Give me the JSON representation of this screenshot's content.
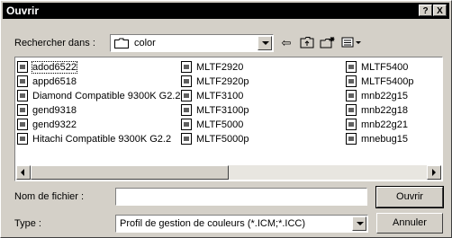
{
  "window": {
    "title": "Ouvrir",
    "help_btn": "?",
    "close_btn": "X"
  },
  "lookin": {
    "label": "Rechercher dans :",
    "value": "color"
  },
  "toolbar": {
    "back_icon": "back-arrow-icon",
    "up_icon": "up-folder-icon",
    "newfolder_icon": "new-folder-icon",
    "view_icon": "view-menu-icon"
  },
  "files": {
    "col1": [
      "adod6522",
      "appd6518",
      "Diamond Compatible 9300K G2.2",
      "gend9318",
      "gend9322",
      "Hitachi Compatible 9300K G2.2"
    ],
    "col2": [
      "MLTF2920",
      "MLTF2920p",
      "MLTF3100",
      "MLTF3100p",
      "MLTF5000",
      "MLTF5000p"
    ],
    "col3": [
      "MLTF5400",
      "MLTF5400p",
      "mnb22g15",
      "mnb22g18",
      "mnb22g21",
      "mnebug15"
    ]
  },
  "filename": {
    "label": "Nom de fichier :",
    "value": ""
  },
  "filetype": {
    "label": "Type :",
    "value": "Profil de gestion de couleurs (*.ICM;*.ICC)"
  },
  "buttons": {
    "open": "Ouvrir",
    "cancel": "Annuler"
  }
}
